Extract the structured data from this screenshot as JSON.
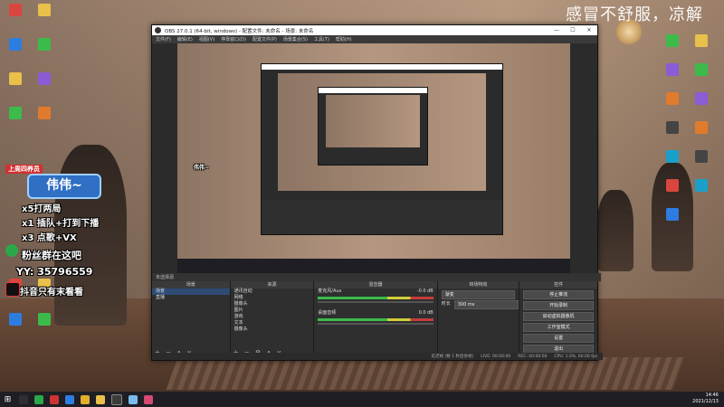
{
  "watermark": "感冒不舒服，凉解",
  "overlay": {
    "role_tag": "上周四养员",
    "badge_name": "伟伟~",
    "lines": [
      "x5打两局",
      "x1 插队+打到下播",
      "x3 点歌+VX",
      "粉丝群在这吧",
      "YY: 35796559",
      "抖音只有末看看"
    ]
  },
  "desktop_icons_left": [
    "",
    "",
    "",
    "",
    "",
    "",
    "",
    "",
    "",
    "",
    "",
    "",
    "",
    "",
    "",
    "",
    "",
    "",
    "",
    ""
  ],
  "desktop_icons_right": [
    "",
    "",
    "",
    "",
    "",
    "",
    "",
    "",
    "",
    "",
    "",
    "",
    ""
  ],
  "obs": {
    "title": "OBS 27.0.1 (64-bit, windows) - 配置文件: 未命名 - 场景: 未命名",
    "menu": [
      "文件(F)",
      "编辑(E)",
      "视图(V)",
      "停靠窗口(D)",
      "配置文件(P)",
      "场景集合(S)",
      "工具(T)",
      "帮助(H)"
    ],
    "source_bar_label": "未选择源",
    "docks": {
      "scenes": {
        "title": "场景",
        "items": [
          "场景",
          "直播"
        ]
      },
      "sources": {
        "title": "来源",
        "items": [
          "通讯自动",
          "网络",
          "摄像头",
          "图片",
          "游戏",
          "文本",
          "摄像头"
        ]
      },
      "mixer": {
        "title": "混音器",
        "channels": [
          "麦克风/Aux",
          "桌面音频"
        ],
        "db_values": [
          "-0.0 dB",
          "0.0 dB"
        ]
      },
      "transitions": {
        "title": "转场特效",
        "type": "渐变",
        "duration_label": "时长",
        "duration_value": "300 ms"
      },
      "controls": {
        "title": "控件",
        "buttons": [
          "停止推流",
          "开始录制",
          "启动虚拟摄像机",
          "工作室模式",
          "设置",
          "退出"
        ]
      }
    },
    "status": {
      "live": "LIVE: 00:00:00",
      "rec": "REC: 00:00:00",
      "cpu": "CPU: 1.0%, 60.00 fps",
      "dropped": "延迟帧 (数 1 秒后各帧)"
    }
  },
  "taskbar": {
    "time": "14:46",
    "date": "2021/12/13"
  }
}
